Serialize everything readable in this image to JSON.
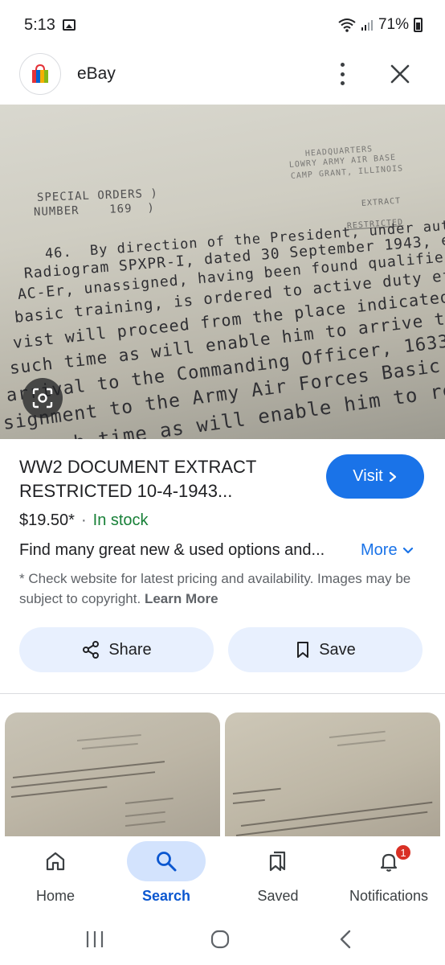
{
  "status_bar": {
    "time": "5:13",
    "battery_percent": "71%"
  },
  "header": {
    "app_name": "eBay"
  },
  "product": {
    "title": "WW2 DOCUMENT EXTRACT RESTRICTED 10-4-1943...",
    "price": "$19.50*",
    "separator": "·",
    "stock": "In stock",
    "find_text": "Find many great new & used options and...",
    "more_label": "More",
    "disclaimer": "* Check website for latest pricing and availability. Images may be subject to copyright.",
    "learn_more": "Learn More",
    "visit_label": "Visit"
  },
  "actions": {
    "share_label": "Share",
    "save_label": "Save"
  },
  "bottom_nav": [
    {
      "label": "Home",
      "icon": "home-icon",
      "active": false
    },
    {
      "label": "Search",
      "icon": "search-icon",
      "active": true
    },
    {
      "label": "Saved",
      "icon": "bookmarks-icon",
      "active": false
    },
    {
      "label": "Notifications",
      "icon": "bell-icon",
      "active": false,
      "badge": "1"
    }
  ],
  "colors": {
    "accent": "#1a73e8",
    "stock_green": "#188038",
    "pill_bg": "#e8f0fe",
    "active_nav_bg": "#d3e3fd",
    "badge_red": "#d93025"
  }
}
